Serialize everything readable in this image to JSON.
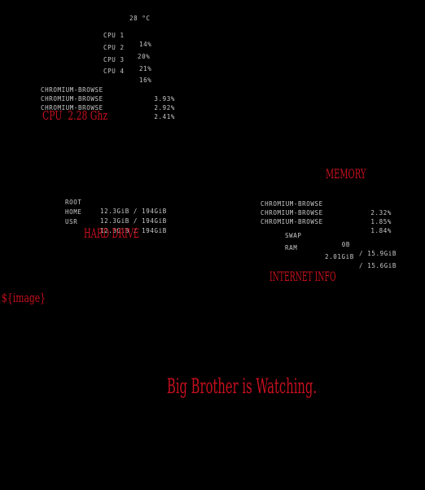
{
  "cpu": {
    "temp": "28 °C",
    "cores": [
      {
        "label": "CPU 1",
        "value": "14%"
      },
      {
        "label": "CPU 2",
        "value": "20%"
      },
      {
        "label": "CPU 3",
        "value": "21%"
      },
      {
        "label": "CPU 4",
        "value": "16%"
      }
    ],
    "processes": [
      {
        "name": "CHROMIUM-BROWSE",
        "value": "3.93%"
      },
      {
        "name": "CHROMIUM-BROWSE",
        "value": "2.92%"
      },
      {
        "name": "CHROMIUM-BROWSE",
        "value": "2.41%"
      }
    ],
    "heading": "CPU  2.28 Ghz"
  },
  "memory": {
    "heading": "MEMORY",
    "processes": [
      {
        "name": "CHROMIUM-BROWSE",
        "value": "2.32%"
      },
      {
        "name": "CHROMIUM-BROWSE",
        "value": "1.85%"
      },
      {
        "name": "CHROMIUM-BROWSE",
        "value": "1.84%"
      }
    ],
    "swap": {
      "label": "SWAP",
      "used": "0B",
      "total": "/ 15.9GiB"
    },
    "ram": {
      "label": "RAM",
      "used": "2.01GiB",
      "total": "/ 15.6GiB"
    }
  },
  "hard_drive": {
    "heading": "HARD DRIVE",
    "mounts": [
      {
        "label": "ROOT",
        "usage": "12.3GiB / 194GiB"
      },
      {
        "label": "HOME",
        "usage": "12.3GiB / 194GiB"
      },
      {
        "label": "USR",
        "usage": "12.3GiB / 194GiB"
      }
    ]
  },
  "internet": {
    "heading": "INTERNET INFO"
  },
  "image_placeholder": "${image}",
  "tagline": "Big Brother is Watching.",
  "colors": {
    "background": "#000000",
    "text": "#c8c8c8",
    "accent": "#c8101e"
  }
}
